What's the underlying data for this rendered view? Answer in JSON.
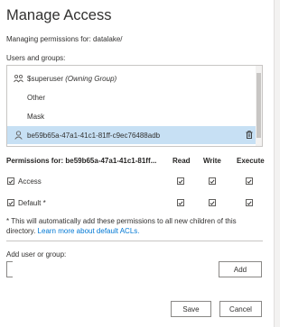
{
  "dialog": {
    "title": "Manage Access",
    "subtitle": "Managing permissions for: datalake/"
  },
  "users_groups": {
    "label": "Users and groups:",
    "items": [
      {
        "icon": "group-icon",
        "name": "$superuser",
        "suffix": "(Owning Group)",
        "selected": false
      },
      {
        "icon": "",
        "name": "Other",
        "suffix": "",
        "selected": false
      },
      {
        "icon": "",
        "name": "Mask",
        "suffix": "",
        "selected": false
      },
      {
        "icon": "user-icon",
        "name": "be59b65a-47a1-41c1-81ff-c9ec76488adb",
        "suffix": "",
        "selected": true
      }
    ]
  },
  "permissions": {
    "header": "Permissions for: be59b65a-47a1-41c1-81ff...",
    "columns": [
      "Read",
      "Write",
      "Execute"
    ],
    "rows": [
      {
        "label": "Access",
        "enabled": true,
        "read": true,
        "write": true,
        "execute": true
      },
      {
        "label": "Default *",
        "enabled": true,
        "read": true,
        "write": true,
        "execute": true
      }
    ]
  },
  "note": {
    "text": "* This will automatically add these permissions to all new children of this directory.",
    "link": "Learn more about default ACLs."
  },
  "add": {
    "label": "Add user or group:",
    "value": "",
    "button": "Add"
  },
  "footer": {
    "save": "Save",
    "cancel": "Cancel"
  }
}
